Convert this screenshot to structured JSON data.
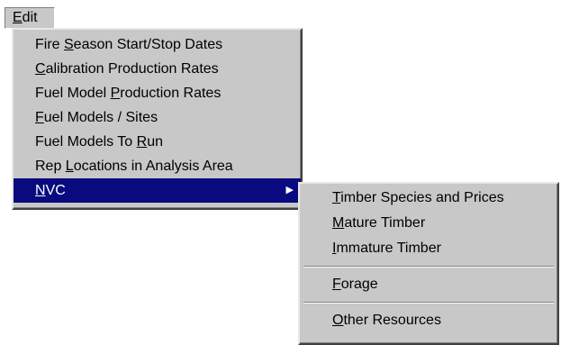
{
  "menubar": {
    "edit": {
      "mnemonic": "E",
      "rest": "dit"
    }
  },
  "edit_menu": {
    "items": [
      {
        "before": "Fire ",
        "mnemonic": "S",
        "after": "eason Start/Stop Dates"
      },
      {
        "before": "",
        "mnemonic": "C",
        "after": "alibration Production Rates"
      },
      {
        "before": "Fuel Model ",
        "mnemonic": "P",
        "after": "roduction Rates"
      },
      {
        "before": "",
        "mnemonic": "F",
        "after": "uel Models / Sites"
      },
      {
        "before": "Fuel Models To ",
        "mnemonic": "R",
        "after": "un"
      },
      {
        "before": "Rep ",
        "mnemonic": "L",
        "after": "ocations in Analysis Area"
      },
      {
        "before": "",
        "mnemonic": "N",
        "after": "VC",
        "arrow": "▶"
      }
    ],
    "selected_index": 6
  },
  "nvc_submenu": {
    "items": [
      {
        "before": "",
        "mnemonic": "T",
        "after": "imber Species and Prices"
      },
      {
        "before": "",
        "mnemonic": "M",
        "after": "ature Timber"
      },
      {
        "before": "",
        "mnemonic": "I",
        "after": "mmature Timber"
      },
      {
        "before": "",
        "mnemonic": "F",
        "after": "orage"
      },
      {
        "before": "",
        "mnemonic": "O",
        "after": "ther Resources"
      }
    ]
  },
  "colors": {
    "menu_bg": "#c8c8c8",
    "highlight_bg": "#0a0a80",
    "highlight_text": "#ffffff"
  }
}
